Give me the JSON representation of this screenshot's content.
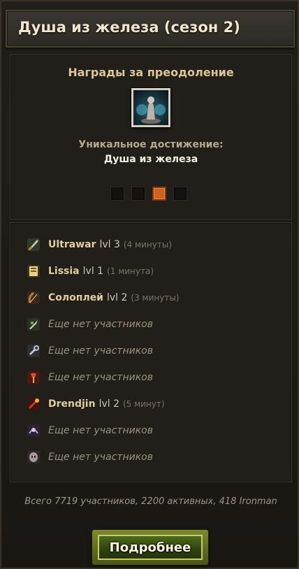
{
  "header": {
    "title": "Душа из железа (сезон 2)"
  },
  "rewards": {
    "title": "Награды за преодоление",
    "achievement_label": "Уникальное достижение:",
    "achievement_name": "Душа из железа",
    "pager": {
      "total": 4,
      "active_index": 2
    }
  },
  "players": [
    {
      "icon": "warrior-sword-icon",
      "name": "Ultrawar",
      "level": "lvl 3",
      "time": "(4 минуты)"
    },
    {
      "icon": "paladin-book-icon",
      "name": "Lissia",
      "level": "lvl 1",
      "time": "(1 минута)"
    },
    {
      "icon": "ranger-bow-icon",
      "name": "Солоплей",
      "level": "lvl 2",
      "time": "(3 минуты)"
    },
    {
      "icon": "rogue-dagger-icon",
      "empty": "Еще нет участников"
    },
    {
      "icon": "engineer-wrench-icon",
      "empty": "Еще нет участников"
    },
    {
      "icon": "berserker-axe-icon",
      "empty": "Еще нет участников"
    },
    {
      "icon": "mage-wand-icon",
      "name": "Drendjin",
      "level": "lvl 2",
      "time": "(5 минут)"
    },
    {
      "icon": "necromancer-claw-icon",
      "empty": "Еще нет участников"
    },
    {
      "icon": "revenant-mask-icon",
      "empty": "Еще нет участников"
    }
  ],
  "footer": {
    "stats": "Всего 7719 участников, 2200 активных, 418 Ironman",
    "details_button": "Подробнее"
  }
}
